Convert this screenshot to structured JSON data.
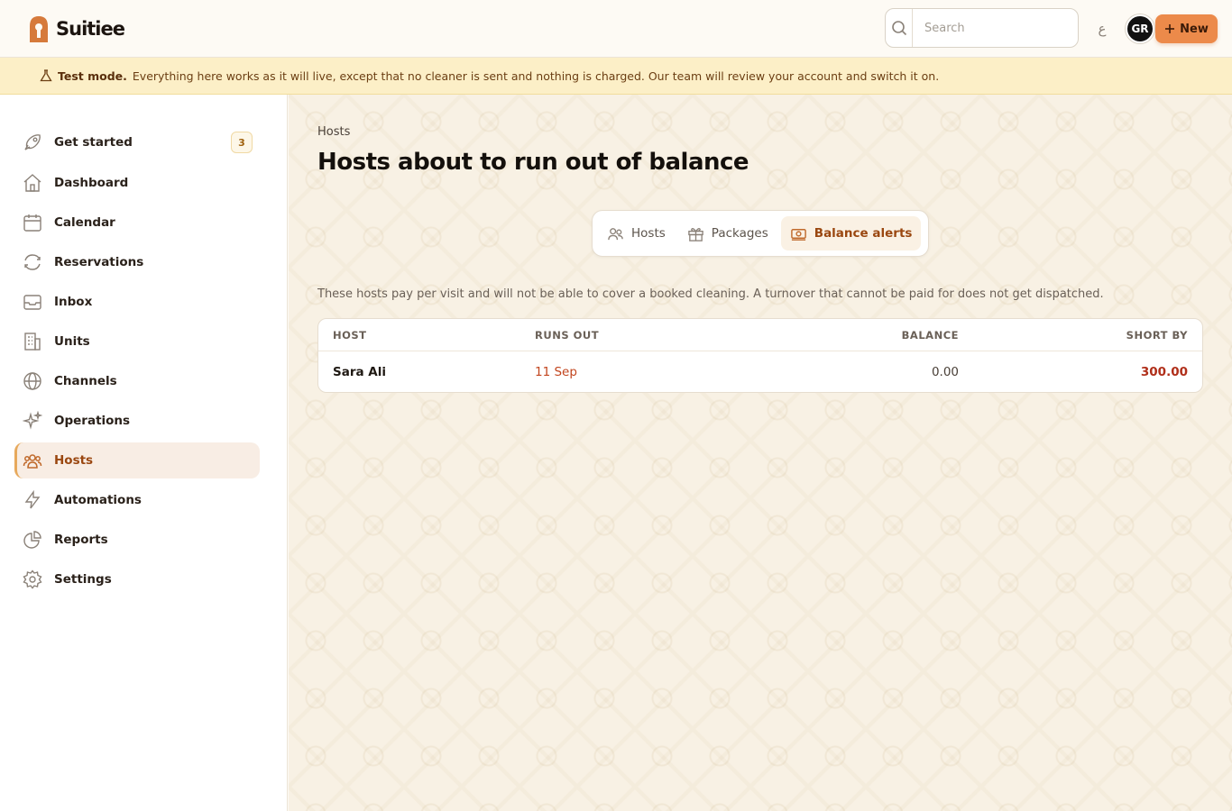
{
  "app": {
    "name": "Suitiee"
  },
  "search": {
    "placeholder": "Search"
  },
  "header": {
    "lang_label": "ع",
    "avatar_initials": "GR",
    "new_label": "New"
  },
  "banner": {
    "title": "Test mode.",
    "text": "Everything here works as it will live, except that no cleaner is sent and nothing is charged. Our team will review your account and switch it on."
  },
  "sidebar": {
    "items": [
      {
        "label": "Get started",
        "icon": "rocket-icon",
        "badge": "3"
      },
      {
        "label": "Dashboard",
        "icon": "home-icon"
      },
      {
        "label": "Calendar",
        "icon": "calendar-icon"
      },
      {
        "label": "Reservations",
        "icon": "refresh-icon"
      },
      {
        "label": "Inbox",
        "icon": "inbox-icon"
      },
      {
        "label": "Units",
        "icon": "building-icon"
      },
      {
        "label": "Channels",
        "icon": "globe-icon"
      },
      {
        "label": "Operations",
        "icon": "sparkles-icon"
      },
      {
        "label": "Hosts",
        "icon": "users-icon",
        "active": true
      },
      {
        "label": "Automations",
        "icon": "bolt-icon"
      },
      {
        "label": "Reports",
        "icon": "pie-chart-icon"
      },
      {
        "label": "Settings",
        "icon": "gear-icon"
      }
    ]
  },
  "main": {
    "breadcrumb": "Hosts",
    "title": "Hosts about to run out of balance",
    "tabs": [
      {
        "label": "Hosts",
        "icon": "users-icon"
      },
      {
        "label": "Packages",
        "icon": "gift-icon"
      },
      {
        "label": "Balance alerts",
        "icon": "banknote-icon",
        "active": true
      }
    ],
    "description": "These hosts pay per visit and will not be able to cover a booked cleaning. A turnover that cannot be paid for does not get dispatched.",
    "table": {
      "headers": [
        "HOST",
        "RUNS OUT",
        "BALANCE",
        "SHORT BY"
      ],
      "rows": [
        {
          "host": "Sara Ali",
          "runs_out": "11 Sep",
          "balance": "0.00",
          "short_by": "300.00"
        }
      ]
    }
  },
  "colors": {
    "accent": "#ec8a4a",
    "active_text": "#9a4710",
    "banner_bg": "#fcefc7",
    "danger": "#b02f1a"
  }
}
